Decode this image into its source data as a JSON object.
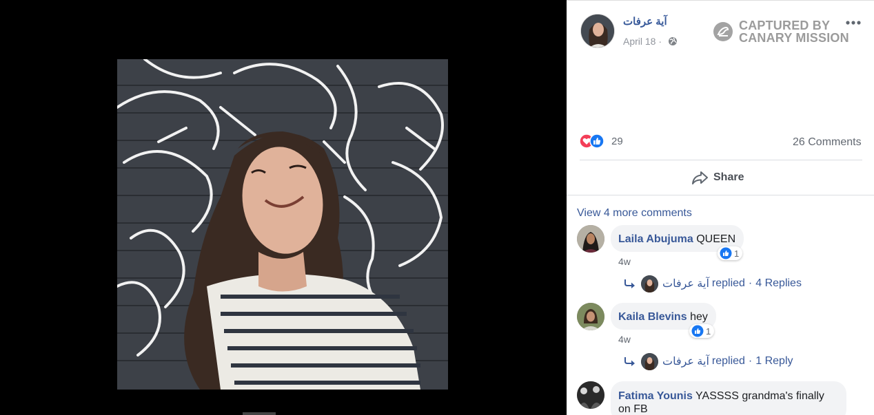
{
  "post": {
    "author_name": "آية عرفات",
    "date": "April 18",
    "date_separator": "·",
    "privacy_icon": "globe-icon"
  },
  "watermark": {
    "line1": "CAPTURED BY",
    "line2": "CANARY MISSION"
  },
  "stats": {
    "reaction_icons": [
      "love-icon",
      "like-icon"
    ],
    "reaction_count": "29",
    "comments_count": "26 Comments"
  },
  "actions": {
    "share_label": "Share"
  },
  "comments_section": {
    "view_more_label": "View 4 more comments",
    "comments": [
      {
        "name": "Laila Abujuma",
        "text": "QUEEN",
        "time": "4w",
        "likes": "1",
        "reply_name": "آية عرفات",
        "reply_action": "replied",
        "reply_count": "4 Replies"
      },
      {
        "name": "Kaila Blevins",
        "text": "hey",
        "time": "4w",
        "likes": "1",
        "reply_name": "آية عرفات",
        "reply_action": "replied",
        "reply_count": "1 Reply"
      },
      {
        "name": "Fatima Younis",
        "text": "YASSSS grandma's finally on FB"
      }
    ]
  },
  "colors": {
    "link_blue": "#385898",
    "like_blue": "#1877f2",
    "love_red": "#f33e58",
    "muted_gray": "#616770",
    "watermark_gray": "#9b9b9b"
  }
}
